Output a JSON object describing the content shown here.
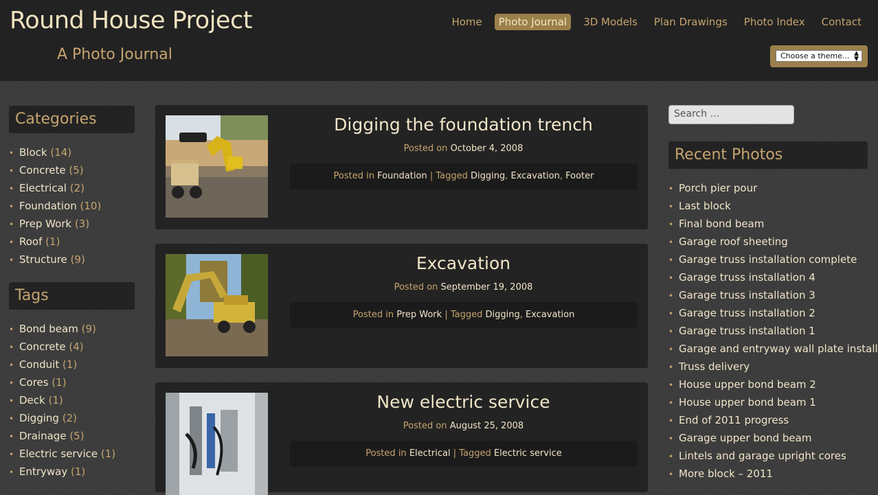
{
  "site": {
    "title": "Round House Project",
    "subtitle": "A Photo Journal"
  },
  "nav": {
    "items": [
      "Home",
      "Photo Journal",
      "3D Models",
      "Plan Drawings",
      "Photo Index",
      "Contact"
    ],
    "active": "Photo Journal"
  },
  "theme_select": {
    "value": "Choose a theme..."
  },
  "categories": {
    "title": "Categories",
    "items": [
      {
        "name": "Block",
        "count": "(14)"
      },
      {
        "name": "Concrete",
        "count": "(5)"
      },
      {
        "name": "Electrical",
        "count": "(2)"
      },
      {
        "name": "Foundation",
        "count": "(10)"
      },
      {
        "name": "Prep Work",
        "count": "(3)"
      },
      {
        "name": "Roof",
        "count": "(1)"
      },
      {
        "name": "Structure",
        "count": "(9)"
      }
    ]
  },
  "tags": {
    "title": "Tags",
    "items": [
      {
        "name": "Bond beam",
        "count": "(9)"
      },
      {
        "name": "Concrete",
        "count": "(4)"
      },
      {
        "name": "Conduit",
        "count": "(1)"
      },
      {
        "name": "Cores",
        "count": "(1)"
      },
      {
        "name": "Deck",
        "count": "(1)"
      },
      {
        "name": "Digging",
        "count": "(2)"
      },
      {
        "name": "Drainage",
        "count": "(5)"
      },
      {
        "name": "Electric service",
        "count": "(1)"
      },
      {
        "name": "Entryway",
        "count": "(1)"
      }
    ]
  },
  "posts": [
    {
      "title": "Digging the foundation trench",
      "posted_on_label": "Posted on",
      "date": "October 4, 2008",
      "posted_in_label": "Posted in",
      "category": "Foundation",
      "tagged_label": "| Tagged",
      "tags": [
        "Digging",
        "Excavation",
        "Footer"
      ]
    },
    {
      "title": "Excavation",
      "posted_on_label": "Posted on",
      "date": "September 19, 2008",
      "posted_in_label": "Posted in",
      "category": "Prep Work",
      "tagged_label": "| Tagged",
      "tags": [
        "Digging",
        "Excavation"
      ]
    },
    {
      "title": "New electric service",
      "posted_on_label": "Posted on",
      "date": "August 25, 2008",
      "posted_in_label": "Posted in",
      "category": "Electrical",
      "tagged_label": "| Tagged",
      "tags": [
        "Electric service"
      ]
    }
  ],
  "search": {
    "placeholder": "Search …"
  },
  "recent_photos": {
    "title": "Recent Photos",
    "items": [
      "Porch pier pour",
      "Last block",
      "Final bond beam",
      "Garage roof sheeting",
      "Garage truss installation complete",
      "Garage truss installation 4",
      "Garage truss installation 3",
      "Garage truss installation 2",
      "Garage truss installation 1",
      "Garage and entryway wall plate installation",
      "Truss delivery",
      "House upper bond beam 2",
      "House upper bond beam 1",
      "End of 2011 progress",
      "Garage upper bond beam",
      "Lintels and garage upright cores",
      "More block – 2011"
    ]
  }
}
